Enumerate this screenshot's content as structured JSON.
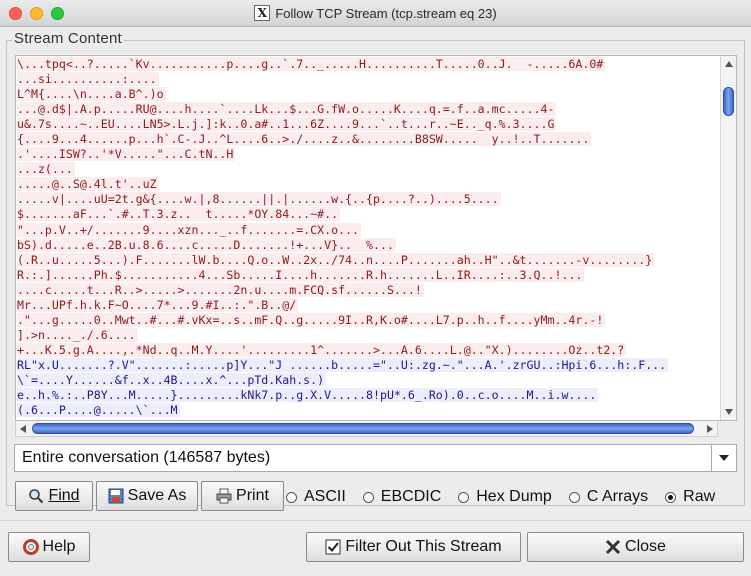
{
  "window": {
    "title": "Follow TCP Stream (tcp.stream eq 23)"
  },
  "panel": {
    "legend": "Stream Content"
  },
  "stream_lines": [
    {
      "dir": "client",
      "text": "\\...tpq<..?.....`Kv...........p....g..`.7.._.....H..........T.....0..J.  -.....6A.0#"
    },
    {
      "dir": "client",
      "text": "...si..........:...."
    },
    {
      "dir": "client",
      "text": "L^M{....\\n....a.B^.)o"
    },
    {
      "dir": "client",
      "text": "...@.d$|.A.p.....RU@....h....`....Lk...$...G.fW.o.....K....q.=.f..a.mc.....4-"
    },
    {
      "dir": "client",
      "text": "u&.7s....~..EU....LN5>.L.j.]:k..0.a#..1...6Z....9...`..t...r..~E.._q.%.3....G"
    },
    {
      "dir": "client",
      "text": "{....9...4......p...h`.C-.J..^L....6..>./....z..&........B8SW.....  y..!..T......."
    },
    {
      "dir": "client",
      "text": ".'....ISW?..'*V.....\"...C.tN..H"
    },
    {
      "dir": "client",
      "text": "...z(..."
    },
    {
      "dir": "client",
      "text": ".....@..S@.4l.t'..uZ"
    },
    {
      "dir": "client",
      "text": ".....v|....uU=2t.g&{....w.|,8......||.|......w.{..{p....?..)....5...."
    },
    {
      "dir": "client",
      "text": "$.......aF...`.#..T.3.z..  t.....*OY.84...~#.."
    },
    {
      "dir": "client",
      "text": "\"...p.V..+/.......9....xzn..._..f.......=.CX.o..."
    },
    {
      "dir": "client",
      "text": "bS).d.....e..2B.u.8.6....c.....D.......!+...V}..  %..."
    },
    {
      "dir": "client",
      "text": "(.R..u.....5...).F.......lW.b....Q.o..W..2x../74..n....P.......ah..H\"..&t.......-v........}"
    },
    {
      "dir": "client",
      "text": "R.:.]......Ph.$...........4...Sb.....I....h.......R.h.......L..IR....:..3.Q..!..."
    },
    {
      "dir": "client",
      "text": "....c.....t...R..>.....>.......2n.u....m.FCQ.sf......S...!"
    },
    {
      "dir": "client",
      "text": "Mr...UPf.h.k.F~O....7*...9.#I..:.\".B..@/"
    },
    {
      "dir": "client",
      "text": ".\"...g.....0..Mwt..#...#.vKx=..s..mF.Q..g.....9I..R,K.o#....L7.p..h..f....yMm..4r.-!"
    },
    {
      "dir": "client",
      "text": "].>n...._./.6...."
    },
    {
      "dir": "client",
      "text": "+...K.5.g.A....,.*Nd..q..M.Y....'.........1^.......>...A.6....L.@..\"X.)........Oz..t2.?"
    },
    {
      "dir": "server",
      "text": "RL\"x.U.......?.V\".......:.....p]Y...\"J ......b.....=\"..U:.zg.~.\"...A.'.zrGU..:Hpi.6...h:.F..."
    },
    {
      "dir": "server",
      "text": "\\`=....Y......&f..x..4B....x.^...pTd.Kah.s.)"
    },
    {
      "dir": "server",
      "text": "e..h.%.:..P8Y...M.....}.........kNk7.p..g.X.V.....8!pU*.6_.Ro).0..c.o....M..i.w...."
    },
    {
      "dir": "server",
      "text": "(.6...P....@.....\\`...M"
    }
  ],
  "conversation_select": {
    "value": "Entire conversation (146587 bytes)"
  },
  "actions": {
    "find_label": "Find",
    "save_as_label": "Save As",
    "print_label": "Print"
  },
  "formats": {
    "options": [
      "ASCII",
      "EBCDIC",
      "Hex Dump",
      "C Arrays",
      "Raw"
    ],
    "selected": "Raw"
  },
  "footer": {
    "help_label": "Help",
    "filter_label": "Filter Out This Stream",
    "close_label": "Close"
  },
  "colors": {
    "client_bg": "#fbeded",
    "client_fg": "#8e1a1a",
    "server_bg": "#ededfb",
    "server_fg": "#1a1a8e",
    "scroll_accent": "#4a74d6"
  }
}
